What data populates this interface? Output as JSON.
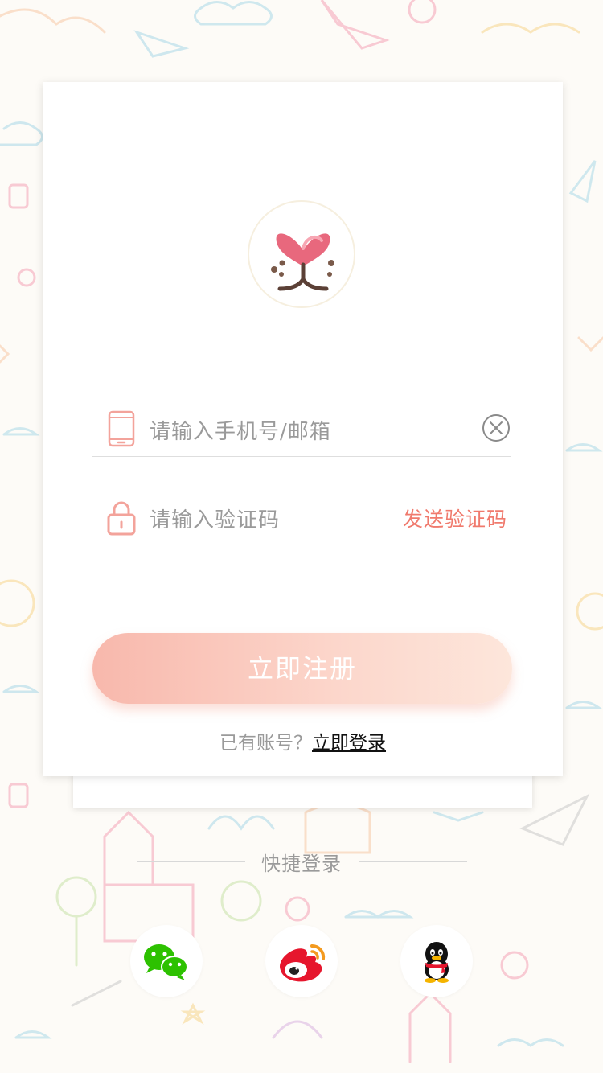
{
  "form": {
    "phone_placeholder": "请输入手机号/邮箱",
    "code_placeholder": "请输入验证码",
    "send_code_label": "发送验证码"
  },
  "actions": {
    "register_label": "立即注册",
    "has_account_text": "已有账号？",
    "login_link_label": "立即登录"
  },
  "quick_login": {
    "title": "快捷登录",
    "providers": [
      {
        "icon": "wechat-icon"
      },
      {
        "icon": "weibo-icon"
      },
      {
        "icon": "qq-icon"
      }
    ]
  },
  "colors": {
    "accent": "#f07a6d",
    "button_gradient_start": "#f8b8ac",
    "button_gradient_end": "#fde6db",
    "icon_pink": "#f3a39b",
    "wechat_green": "#2dc100",
    "weibo_red": "#e6162d"
  }
}
